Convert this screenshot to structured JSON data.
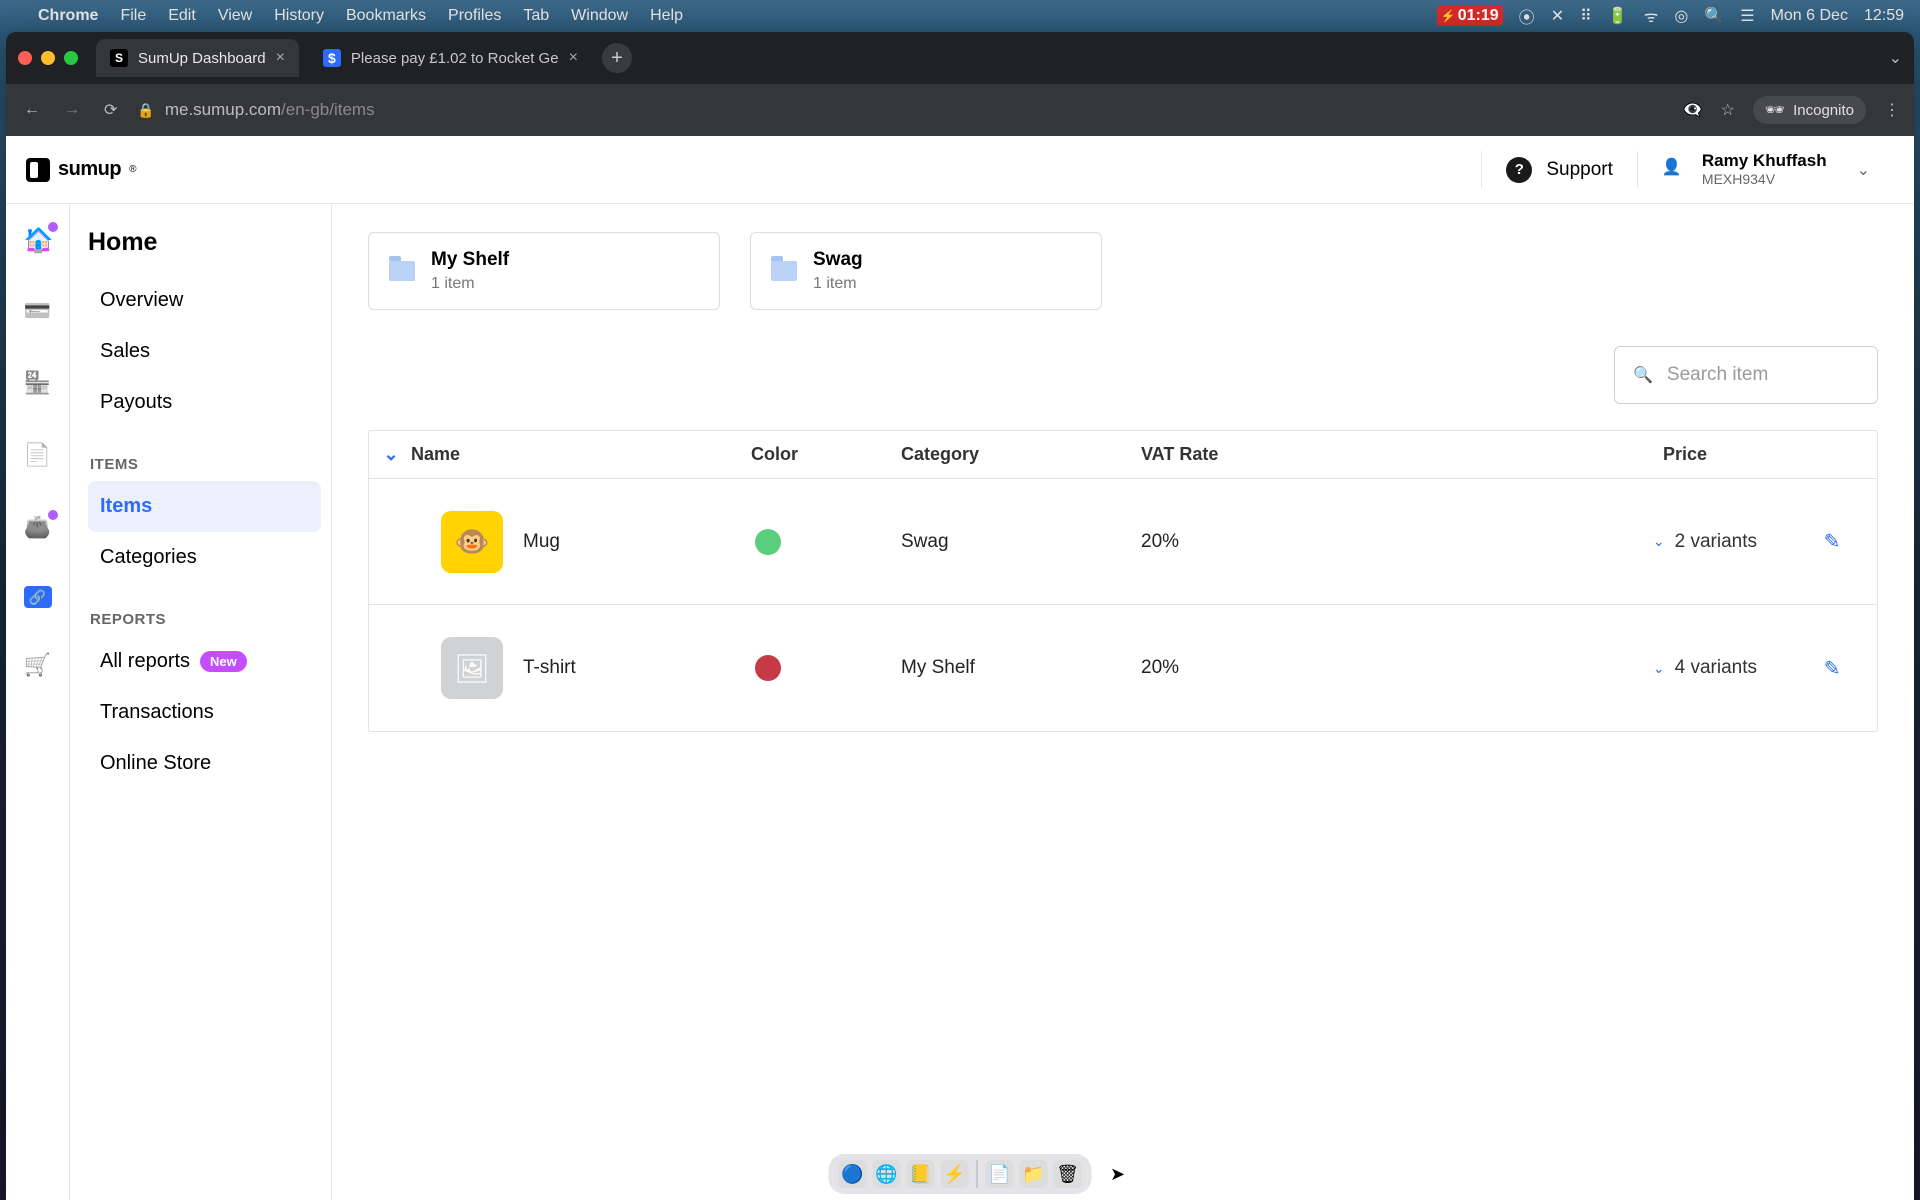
{
  "mac_menu": {
    "app": "Chrome",
    "items": [
      "File",
      "Edit",
      "View",
      "History",
      "Bookmarks",
      "Profiles",
      "Tab",
      "Window",
      "Help"
    ],
    "battery_time": "01:19",
    "date": "Mon 6 Dec",
    "clock": "12:59"
  },
  "chrome": {
    "tabs": [
      {
        "favicon_label": "S",
        "title": "SumUp Dashboard",
        "active": true
      },
      {
        "favicon_label": "$",
        "title": "Please pay £1.02 to Rocket Ge",
        "active": false
      }
    ],
    "url_host": "me.sumup.com",
    "url_path": "/en-gb/items",
    "incognito_label": "Incognito"
  },
  "app_top": {
    "brand": "sumup",
    "support": "Support",
    "user_name": "Ramy Khuffash",
    "user_id": "MEXH934V"
  },
  "sidebar": {
    "home": "Home",
    "nav_home": [
      "Overview",
      "Sales",
      "Payouts"
    ],
    "section_items": "ITEMS",
    "items": "Items",
    "categories": "Categories",
    "section_reports": "REPORTS",
    "all_reports": "All reports",
    "new_badge": "New",
    "transactions": "Transactions",
    "online_store": "Online Store"
  },
  "folders": [
    {
      "name": "My Shelf",
      "count": "1 item"
    },
    {
      "name": "Swag",
      "count": "1 item"
    }
  ],
  "search_placeholder": "Search item",
  "table": {
    "headers": {
      "name": "Name",
      "color": "Color",
      "category": "Category",
      "vat": "VAT Rate",
      "price": "Price"
    },
    "rows": [
      {
        "name": "Mug",
        "swatch": "#5ace7d",
        "category": "Swag",
        "vat": "20%",
        "variants": "2 variants",
        "thumb_class": "yellow",
        "thumb_glyph": "🐵"
      },
      {
        "name": "T-shirt",
        "swatch": "#c53a45",
        "category": "My Shelf",
        "vat": "20%",
        "variants": "4 variants",
        "thumb_class": "gray",
        "thumb_glyph": "🖼"
      }
    ]
  }
}
